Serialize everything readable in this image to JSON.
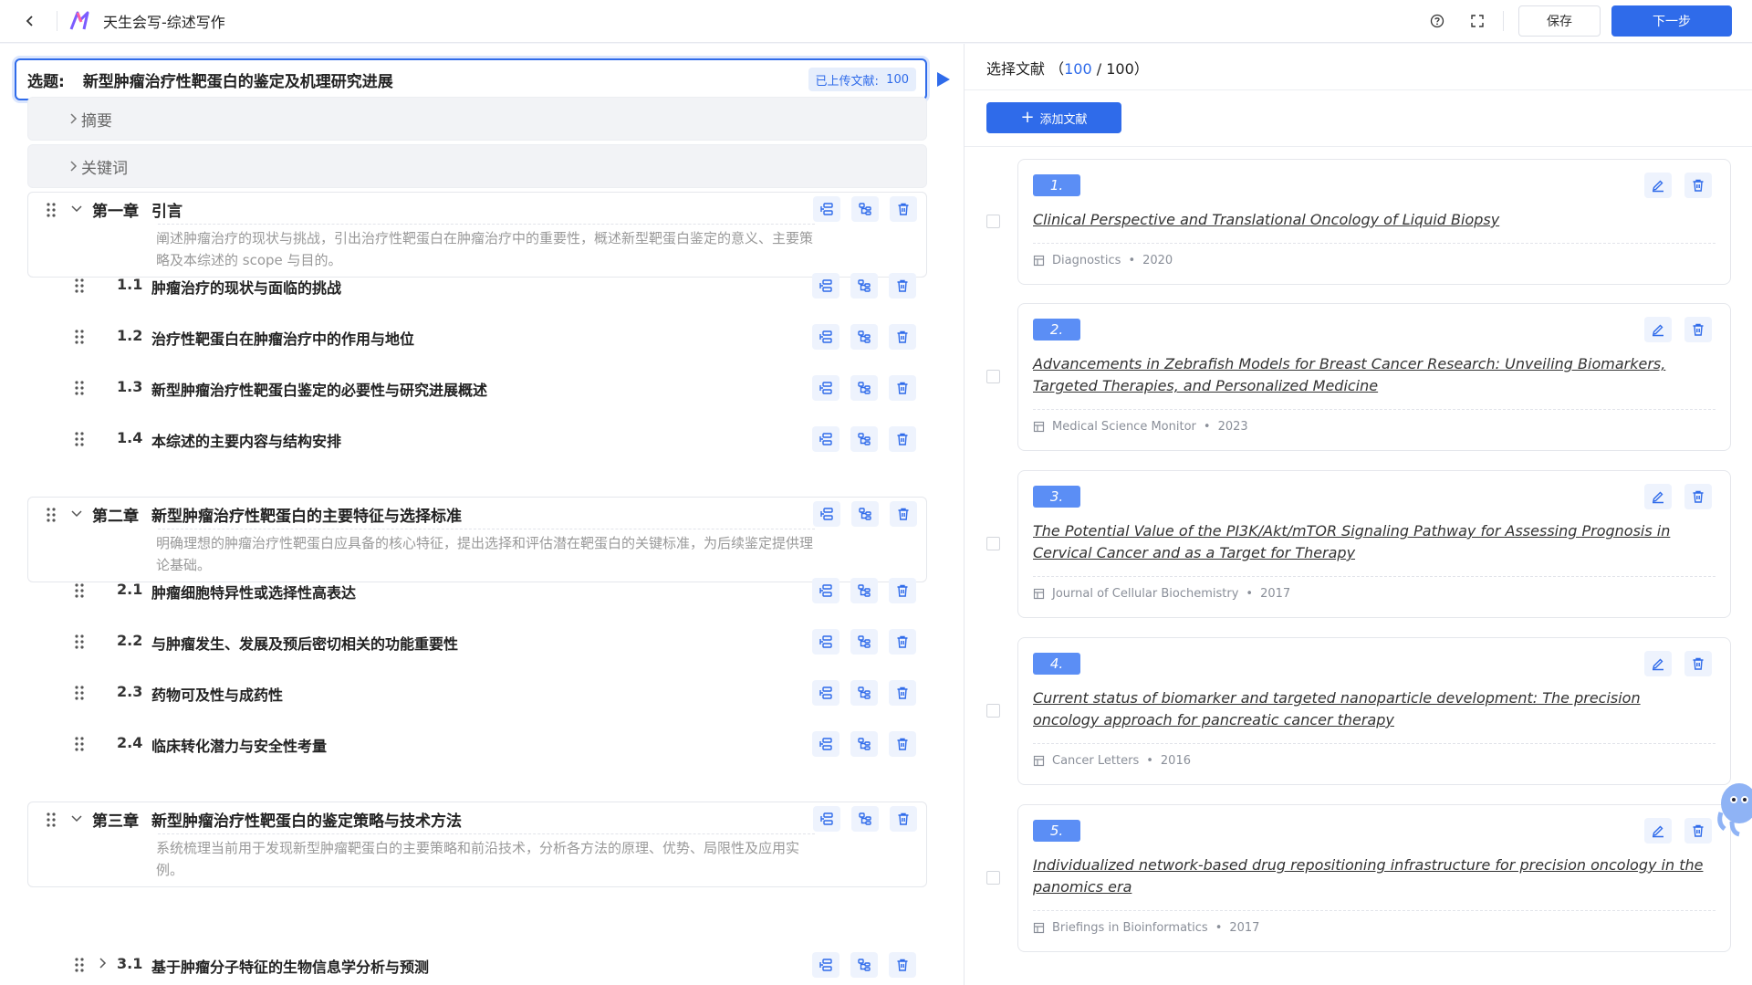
{
  "app": {
    "title": "天生会写-综述写作"
  },
  "toolbar": {
    "save_label": "保存",
    "next_label": "下一步",
    "help_icon": "help-circle-icon",
    "fullscreen_icon": "fullscreen-icon"
  },
  "topic": {
    "label": "选题:",
    "text": "新型肿瘤治疗性靶蛋白的鉴定及机理研究进展",
    "uploaded_label": "已上传文献:",
    "uploaded_count": "100"
  },
  "collapsed_sections": [
    {
      "label": "摘要"
    },
    {
      "label": "关键词"
    }
  ],
  "outline": {
    "chapters": [
      {
        "num": "第一章",
        "title": "引言",
        "desc": "阐述肿瘤治疗的现状与挑战，引出治疗性靶蛋白在肿瘤治疗中的重要性，概述新型靶蛋白鉴定的意义、主要策略及本综述的 scope 与目的。",
        "sections": [
          {
            "num": "1.1",
            "title": "肿瘤治疗的现状与面临的挑战"
          },
          {
            "num": "1.2",
            "title": "治疗性靶蛋白在肿瘤治疗中的作用与地位"
          },
          {
            "num": "1.3",
            "title": "新型肿瘤治疗性靶蛋白鉴定的必要性与研究进展概述"
          },
          {
            "num": "1.4",
            "title": "本综述的主要内容与结构安排"
          }
        ]
      },
      {
        "num": "第二章",
        "title": "新型肿瘤治疗性靶蛋白的主要特征与选择标准",
        "desc": "明确理想的肿瘤治疗性靶蛋白应具备的核心特征，提出选择和评估潜在靶蛋白的关键标准，为后续鉴定提供理论基础。",
        "sections": [
          {
            "num": "2.1",
            "title": "肿瘤细胞特异性或选择性高表达"
          },
          {
            "num": "2.2",
            "title": "与肿瘤发生、发展及预后密切相关的功能重要性"
          },
          {
            "num": "2.3",
            "title": "药物可及性与成药性"
          },
          {
            "num": "2.4",
            "title": "临床转化潜力与安全性考量"
          }
        ]
      },
      {
        "num": "第三章",
        "title": "新型肿瘤治疗性靶蛋白的鉴定策略与技术方法",
        "desc": "系统梳理当前用于发现新型肿瘤靶蛋白的主要策略和前沿技术，分析各方法的原理、优势、局限性及应用实例。",
        "sections": [
          {
            "num": "3.1",
            "title": "基于肿瘤分子特征的生物信息学分析与预测"
          }
        ]
      }
    ]
  },
  "references": {
    "header_label": "选择文献",
    "selected": "100",
    "total": "100",
    "add_label": "添加文献",
    "items": [
      {
        "num": "1.",
        "title": "Clinical Perspective and Translational Oncology of Liquid Biopsy",
        "journal": "Diagnostics",
        "year": "2020"
      },
      {
        "num": "2.",
        "title": "Advancements in Zebrafish Models for Breast Cancer Research: Unveiling Biomarkers, Targeted Therapies, and Personalized Medicine",
        "journal": "Medical Science Monitor",
        "year": "2023"
      },
      {
        "num": "3.",
        "title": "The Potential Value of the PI3K/Akt/mTOR Signaling Pathway for Assessing Prognosis in Cervical Cancer and as a Target for Therapy",
        "journal": "Journal of Cellular Biochemistry",
        "year": "2017"
      },
      {
        "num": "4.",
        "title": "Current status of biomarker and targeted nanoparticle development: The precision oncology approach for pancreatic cancer therapy",
        "journal": "Cancer Letters",
        "year": "2016"
      },
      {
        "num": "5.",
        "title": "Individualized network-based drug repositioning infrastructure for precision oncology in the panomics era",
        "journal": "Briefings in Bioinformatics",
        "year": "2017"
      }
    ]
  },
  "colors": {
    "primary": "#2f6bea",
    "ref_badge": "#5b8ef5",
    "action_bg": "#eef3fd"
  }
}
